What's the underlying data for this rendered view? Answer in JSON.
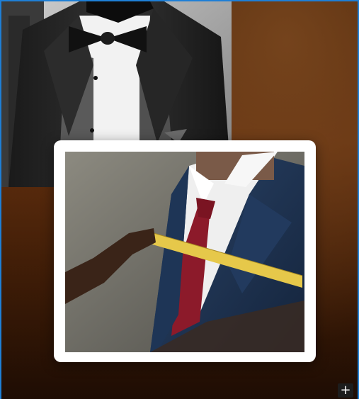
{
  "images": {
    "back_photo_label": "tuxedo-on-mannequin",
    "front_photo_label": "tailor-measuring-suit"
  },
  "controls": {
    "add_icon": "plus-icon",
    "add_symbol": "+"
  },
  "colors": {
    "selection_border": "#1e7fd6",
    "background_wood": "#6a3310",
    "frame": "#ffffff"
  }
}
